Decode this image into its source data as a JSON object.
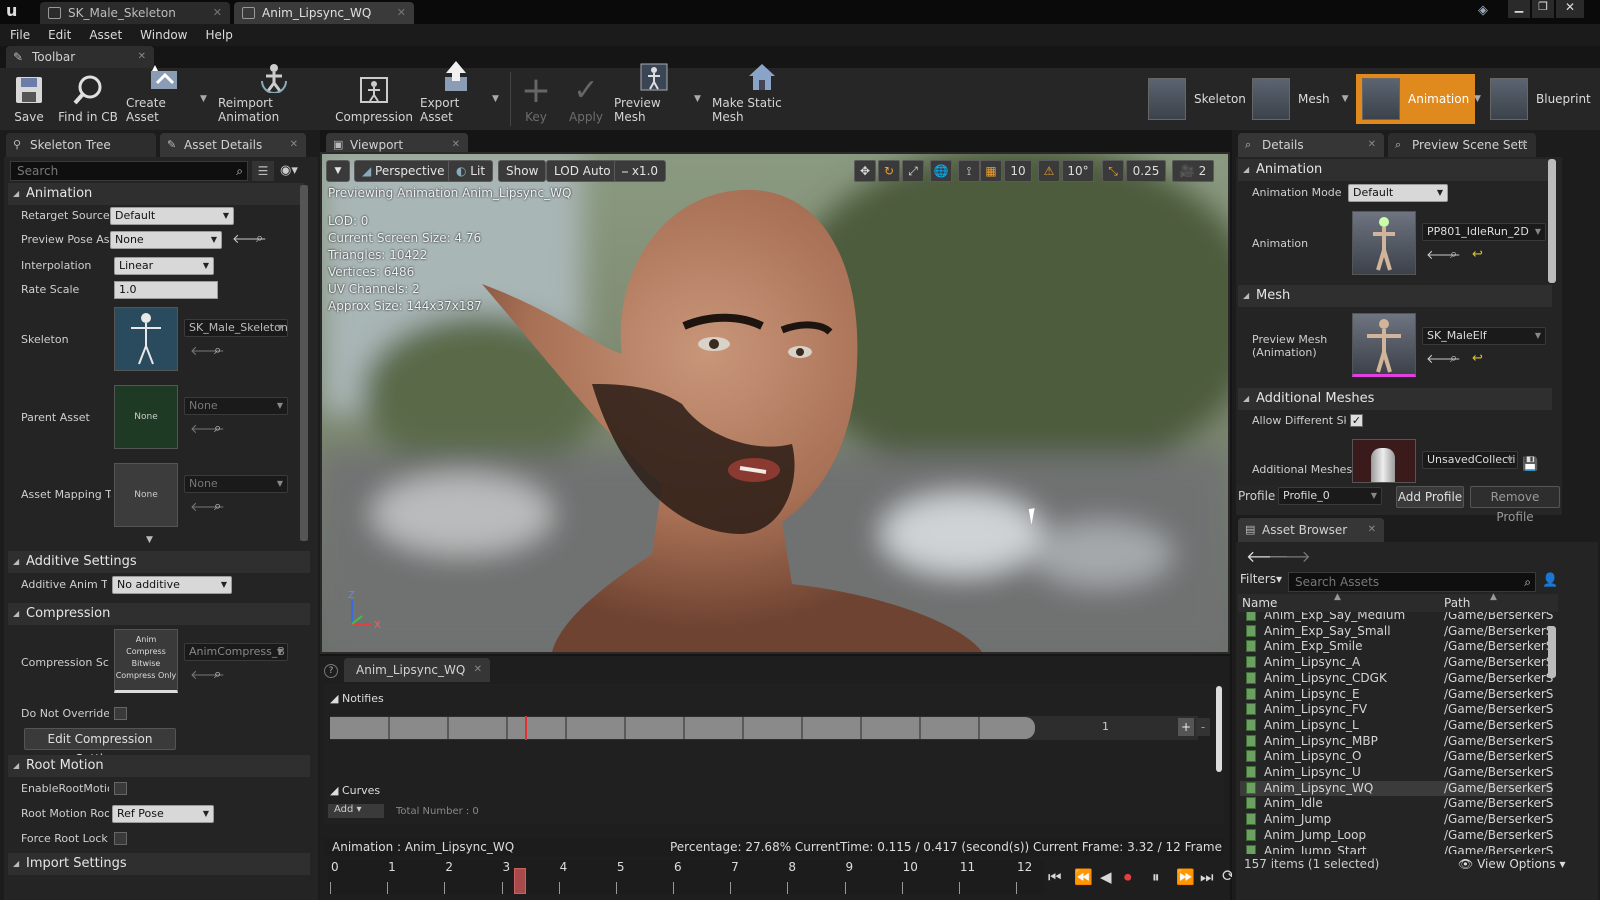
{
  "window": {
    "tabs": [
      {
        "label": "SK_Male_Skeleton"
      },
      {
        "label": "Anim_Lipsync_WQ"
      }
    ]
  },
  "menu": [
    "File",
    "Edit",
    "Asset",
    "Window",
    "Help"
  ],
  "toolbar": {
    "tab_label": "Toolbar",
    "buttons": [
      "Save",
      "Find in CB",
      "Create Asset",
      "Reimport Animation",
      "Compression",
      "Export Asset",
      "Key",
      "Apply",
      "Preview Mesh",
      "Make Static Mesh"
    ],
    "modes": [
      "Skeleton",
      "Mesh",
      "Animation",
      "Blueprint"
    ]
  },
  "left": {
    "tabs": [
      "Skeleton Tree",
      "Asset Details"
    ],
    "search_placeholder": "Search",
    "animation": {
      "header": "Animation",
      "retarget_label": "Retarget Source",
      "retarget_value": "Default",
      "preview_pose_label": "Preview Pose As",
      "preview_pose_value": "None",
      "interp_label": "Interpolation",
      "interp_value": "Linear",
      "rate_label": "Rate Scale",
      "rate_value": "1.0",
      "skeleton_label": "Skeleton",
      "skeleton_value": "SK_Male_Skeleton",
      "parent_label": "Parent Asset",
      "parent_thumb": "None",
      "parent_value": "None",
      "mapping_label": "Asset Mapping Ta",
      "mapping_thumb": "None",
      "mapping_value": "None"
    },
    "additive": {
      "header": "Additive Settings",
      "label": "Additive Anim Ty",
      "value": "No additive"
    },
    "compression": {
      "header": "Compression",
      "scheme_label": "Compression Sch",
      "thumb_text": "Anim Compress Bitwise Compress Only",
      "scheme_value": "AnimCompress_B",
      "override_label": "Do Not Override C",
      "edit_button": "Edit Compression Settings"
    },
    "root_motion": {
      "header": "Root Motion",
      "enable_label": "EnableRootMotio",
      "root_label": "Root Motion Root",
      "root_value": "Ref Pose",
      "force_label": "Force Root Lock"
    },
    "import": {
      "header": "Import Settings"
    }
  },
  "viewport": {
    "tab_label": "Viewport",
    "buttons": {
      "perspective": "Perspective",
      "lit": "Lit",
      "show": "Show",
      "lod": "LOD Auto",
      "speed": "x1.0"
    },
    "grid": {
      "snap": "10",
      "angle": "10°",
      "scale": "0.25",
      "camera": "2"
    },
    "previewing": "Previewing Animation Anim_Lipsync_WQ",
    "stats": [
      "LOD: 0",
      "Current Screen Size: 4.76",
      "Triangles: 10422",
      "Vertices: 6486",
      "UV Channels: 2",
      "Approx Size: 144x37x187"
    ]
  },
  "anim_panel": {
    "tab_label": "Anim_Lipsync_WQ",
    "notifies_header": "Notifies",
    "track_number": "1",
    "curves_header": "Curves",
    "add_label": "Add",
    "total_label": "Total Number : 0",
    "status_left": "Animation :  Anim_Lipsync_WQ",
    "status_right": "Percentage:  27.68% CurrentTime:  0.115 / 0.417 (second(s)) Current Frame:  3.32 / 12 Frame",
    "timeline_numbers": [
      "0",
      "1",
      "2",
      "3",
      "4",
      "5",
      "6",
      "7",
      "8",
      "9",
      "10",
      "11",
      "12"
    ],
    "playhead_frame": 3.32,
    "total_frames": 12
  },
  "details": {
    "tabs": [
      "Details",
      "Preview Scene Sett"
    ],
    "animation_header": "Animation",
    "mode_label": "Animation Mode",
    "mode_value": "Default",
    "anim_label": "Animation",
    "anim_value": "PP801_IdleRun_2D",
    "mesh_header": "Mesh",
    "preview_mesh_label": "Preview Mesh (Animation)",
    "preview_mesh_value": "SK_MaleElf",
    "additional_header": "Additional Meshes",
    "allow_label": "Allow Different Ske",
    "additional_label": "Additional Meshes",
    "additional_value": "UnsavedCollecti",
    "profile_label": "Profile",
    "profile_value": "Profile_0",
    "add_profile": "Add Profile",
    "remove_profile": "Remove Profile"
  },
  "asset_browser": {
    "tab_label": "Asset Browser",
    "filters": "Filters",
    "search_placeholder": "Search Assets",
    "col_name": "Name",
    "col_path": "Path",
    "rows": [
      {
        "name": "Anim_Exp_Say_Medium",
        "path": "/Game/BerserkerS"
      },
      {
        "name": "Anim_Exp_Say_Small",
        "path": "/Game/BerserkerS"
      },
      {
        "name": "Anim_Exp_Smile",
        "path": "/Game/BerserkerS"
      },
      {
        "name": "Anim_Lipsync_A",
        "path": "/Game/BerserkerS"
      },
      {
        "name": "Anim_Lipsync_CDGK",
        "path": "/Game/BerserkerS"
      },
      {
        "name": "Anim_Lipsync_E",
        "path": "/Game/BerserkerS"
      },
      {
        "name": "Anim_Lipsync_FV",
        "path": "/Game/BerserkerS"
      },
      {
        "name": "Anim_Lipsync_L",
        "path": "/Game/BerserkerS"
      },
      {
        "name": "Anim_Lipsync_MBP",
        "path": "/Game/BerserkerS"
      },
      {
        "name": "Anim_Lipsync_O",
        "path": "/Game/BerserkerS"
      },
      {
        "name": "Anim_Lipsync_U",
        "path": "/Game/BerserkerS"
      },
      {
        "name": "Anim_Lipsync_WQ",
        "path": "/Game/BerserkerS"
      },
      {
        "name": "Anim_Idle",
        "path": "/Game/BerserkerS"
      },
      {
        "name": "Anim_Jump",
        "path": "/Game/BerserkerS"
      },
      {
        "name": "Anim_Jump_Loop",
        "path": "/Game/BerserkerS"
      },
      {
        "name": "Anim_Jump_Start",
        "path": "/Game/BerserkerS"
      }
    ],
    "selected_index": 11,
    "count": "157 items (1 selected)",
    "view_options": "View Options"
  },
  "colors": {
    "accent": "#e08a1e",
    "panel": "#242424",
    "background": "#151515"
  }
}
